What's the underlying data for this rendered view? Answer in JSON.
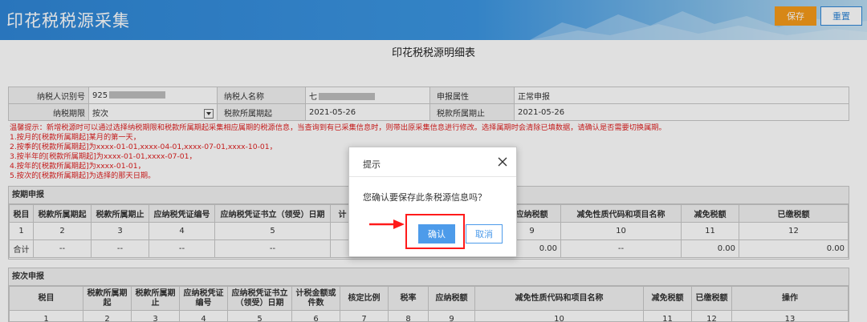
{
  "header": {
    "title": "印花税税源采集",
    "save_label": "保存",
    "reset_label": "重置"
  },
  "page": {
    "title": "印花税税源明细表"
  },
  "info": {
    "row1": {
      "taxpayer_id_label": "纳税人识别号",
      "taxpayer_id_value": "925",
      "taxpayer_name_label": "纳税人名称",
      "taxpayer_name_value": "七",
      "filing_attr_label": "申报属性",
      "filing_attr_value": "正常申报"
    },
    "row2": {
      "period_label": "纳税期限",
      "period_value": "按次",
      "start_label": "税款所属期起",
      "start_value": "2021-05-26",
      "end_label": "税款所属期止",
      "end_value": "2021-05-26"
    }
  },
  "tips": [
    "温馨提示：新增税源时可以通过选择纳税期限和税款所属期起采集相应属期的税源信息，当查询到有已采集信息时，则带出原采集信息进行修改。选择属期时会清除已填数据，请确认是否需要切换属期。",
    "1.按月的[税款所属期起]某月的第一天，",
    "2.按季的[税款所属期起]为xxxx-01-01,xxxx-04-01,xxxx-07-01,xxxx-10-01，",
    "3.按半年的[税款所属期起]为xxxx-01-01,xxxx-07-01，",
    "4.按年的[税款所属期起]为xxxx-01-01，",
    "5.按次的[税款所属期起]为选择的那天日期。"
  ],
  "periodic": {
    "title": "按期申报",
    "headers": [
      "税目",
      "税款所属期起",
      "税款所属期止",
      "应纳税凭证编号",
      "应纳税凭证书立（领受）日期",
      "计",
      "",
      "应纳税额",
      "减免性质代码和项目名称",
      "减免税额",
      "已缴税额"
    ],
    "numbers": [
      "1",
      "2",
      "3",
      "4",
      "5",
      "",
      "",
      "9",
      "10",
      "11",
      "12"
    ],
    "total": [
      "合计",
      "--",
      "--",
      "--",
      "--",
      "",
      "",
      "0.00",
      "--",
      "0.00",
      "0.00"
    ]
  },
  "per_use": {
    "title": "按次申报",
    "headers": [
      "税目",
      "税款所属期起",
      "税款所属期止",
      "应纳税凭证编号",
      "应纳税凭证书立（领受）日期",
      "计税金额或件数",
      "核定比例",
      "税率",
      "应纳税额",
      "减免性质代码和项目名称",
      "减免税额",
      "已缴税额",
      "操作"
    ],
    "numbers": [
      "1",
      "2",
      "3",
      "4",
      "5",
      "6",
      "7",
      "8",
      "9",
      "10",
      "11",
      "12",
      "13"
    ]
  },
  "dialog": {
    "title": "提示",
    "message": "您确认要保存此条税源信息吗？",
    "ok_label": "确认",
    "cancel_label": "取消"
  },
  "colors": {
    "header_blue": "#2f86d6",
    "save_orange": "#f59a1a",
    "tip_red": "#e02020",
    "dialog_button_blue": "#4d9bea",
    "annotation_red": "#ff1a1a"
  }
}
